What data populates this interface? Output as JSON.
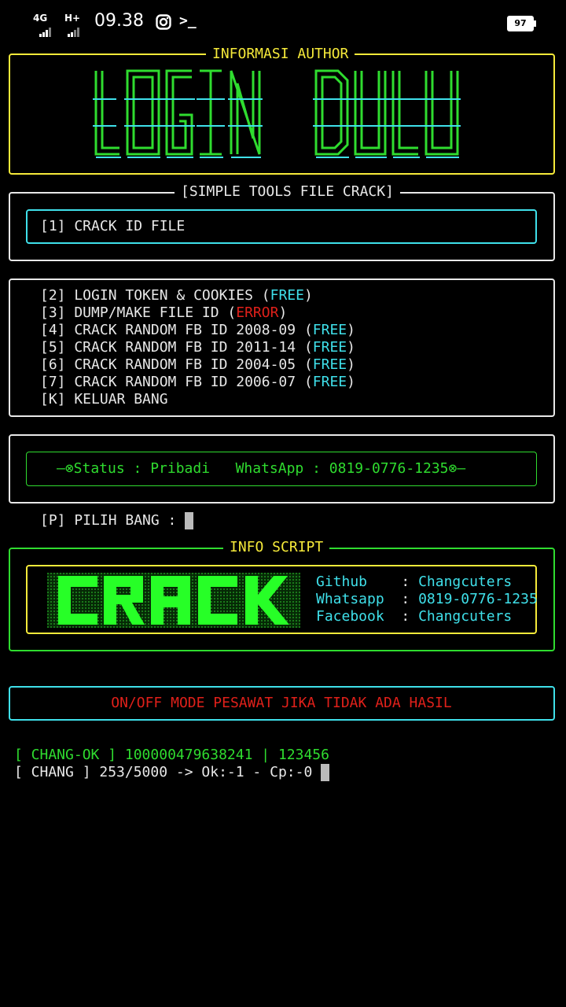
{
  "status_bar": {
    "network_1": "4G",
    "network_2": "H+",
    "time": "09.38",
    "icons": [
      "instagram-icon",
      "terminal-icon"
    ],
    "terminal_glyph": ">_",
    "battery": "97"
  },
  "author_box": {
    "title": "INFORMASI AUTHOR",
    "banner_art": "LOGIN DULU",
    "border_color": "#f6ea3a"
  },
  "tools_box": {
    "title": "[SIMPLE TOOLS FILE CRACK]",
    "selected_item": "[1] CRACK ID FILE"
  },
  "menu": {
    "items": [
      {
        "label": "[2] LOGIN TOKEN & COOKIES (",
        "tag": "FREE",
        "tag_color": "#3fe0ea",
        "close": ")"
      },
      {
        "label": "[3] DUMP/MAKE FILE ID (",
        "tag": "ERROR",
        "tag_color": "#e0201a",
        "close": ")"
      },
      {
        "label": "[4] CRACK RANDOM FB ID 2008-09 (",
        "tag": "FREE",
        "tag_color": "#3fe0ea",
        "close": ")"
      },
      {
        "label": "[5] CRACK RANDOM FB ID 2011-14 (",
        "tag": "FREE",
        "tag_color": "#3fe0ea",
        "close": ")"
      },
      {
        "label": "[6] CRACK RANDOM FB ID 2004-05 (",
        "tag": "FREE",
        "tag_color": "#3fe0ea",
        "close": ")"
      },
      {
        "label": "[7] CRACK RANDOM FB ID 2006-07 (",
        "tag": "FREE",
        "tag_color": "#3fe0ea",
        "close": ")"
      },
      {
        "label": "[K] KELUAR BANG",
        "tag": "",
        "tag_color": "",
        "close": ""
      }
    ]
  },
  "status_box": {
    "text": "—⊗Status : Pribadi   WhatsApp : 0819-0776-1235⊗—"
  },
  "prompt": {
    "text": "[P] PILIH BANG : "
  },
  "info_box": {
    "title": "INFO SCRIPT",
    "banner_art": "CRACK",
    "rows": [
      {
        "key": "Github   ",
        "sep": " : ",
        "value": "Changcuters"
      },
      {
        "key": "Whatsapp ",
        "sep": " : ",
        "value": "0819-0776-1235"
      },
      {
        "key": "Facebook ",
        "sep": " : ",
        "value": "Changcuters"
      }
    ]
  },
  "notice": {
    "text": "ON/OFF MODE PESAWAT JIKA TIDAK ADA HASIL"
  },
  "log": {
    "ok_line": "[ CHANG-OK ] 100000479638241 | 123456",
    "progress_line": "[ CHANG ] 253/5000 -> Ok:-1 - Cp:-0 "
  },
  "colors": {
    "yellow": "#f6ea3a",
    "cyan": "#3fe0ea",
    "green": "#2fdc2f",
    "red": "#e0201a",
    "white": "#e8e8e8"
  }
}
